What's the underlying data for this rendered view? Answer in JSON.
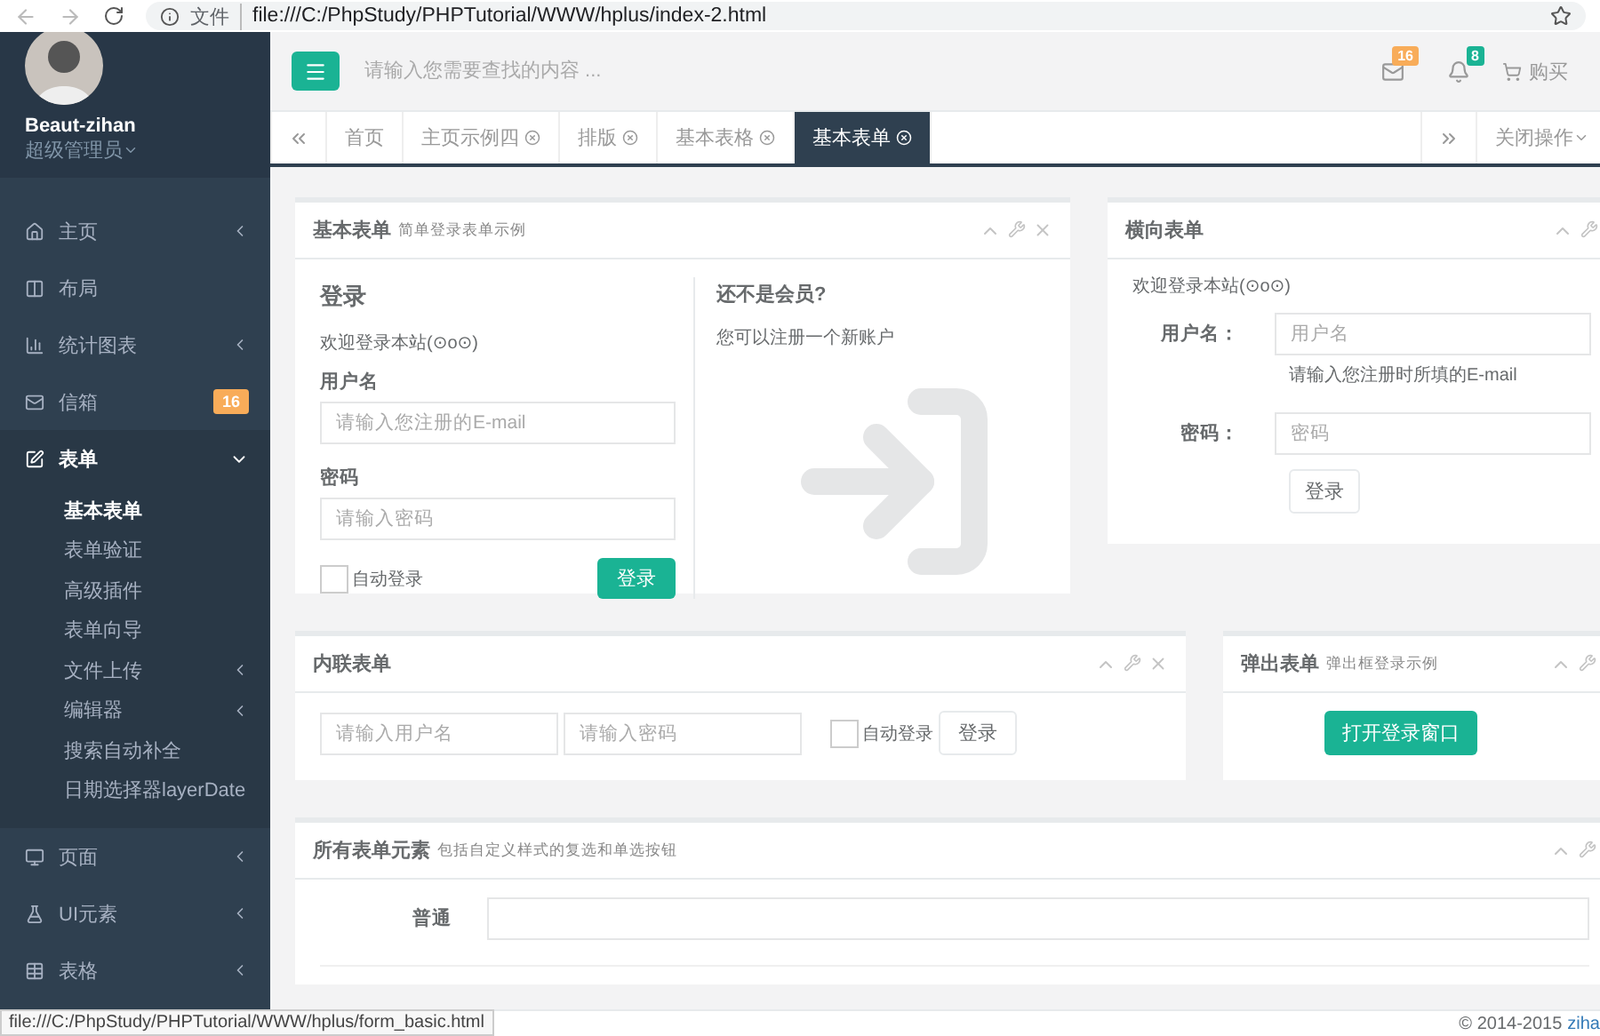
{
  "browser": {
    "scheme_label": "文件",
    "url": "file:///C:/PhpStudy/PHPTutorial/WWW/hplus/index-2.html"
  },
  "sidebar": {
    "profile": {
      "name": "Beaut-zihan",
      "role": "超级管理员"
    },
    "items": [
      {
        "label": "主页",
        "expanded": false
      },
      {
        "label": "布局"
      },
      {
        "label": "统计图表",
        "expanded": false
      },
      {
        "label": "信箱",
        "badge": "16"
      },
      {
        "label": "表单",
        "expanded": true,
        "children": [
          {
            "label": "基本表单",
            "selected": true
          },
          {
            "label": "表单验证",
            "selected": false
          },
          {
            "label": "高级插件",
            "selected": false
          },
          {
            "label": "表单向导",
            "selected": false
          },
          {
            "label": "文件上传",
            "selected": false,
            "expanded": false
          },
          {
            "label": "编辑器",
            "selected": false,
            "expanded": false
          },
          {
            "label": "搜索自动补全",
            "selected": false
          },
          {
            "label": "日期选择器layerDate",
            "selected": false
          }
        ]
      },
      {
        "label": "页面",
        "expanded": false
      },
      {
        "label": "UI元素",
        "expanded": false
      },
      {
        "label": "表格",
        "expanded": false
      }
    ]
  },
  "header": {
    "search": {
      "placeholder": "请输入您需要查找的内容 ..."
    },
    "mail_count": "16",
    "alert_count": "8",
    "buy": "购买"
  },
  "tabs": {
    "items": [
      {
        "label": "首页",
        "selected": false,
        "closable": false
      },
      {
        "label": "主页示例四",
        "selected": false,
        "closable": true
      },
      {
        "label": "排版",
        "selected": false,
        "closable": true
      },
      {
        "label": "基本表格",
        "selected": false,
        "closable": true
      },
      {
        "label": "基本表单",
        "selected": true,
        "closable": true
      }
    ],
    "close_menu": "关闭操作"
  },
  "basic_form": {
    "title": "基本表单",
    "subtitle": "简单登录表单示例",
    "heading": "登录",
    "welcome": "欢迎登录本站(⊙o⊙)",
    "username_label": "用户名",
    "username_placeholder": "请输入您注册的E-mail",
    "password_label": "密码",
    "password_placeholder": "请输入密码",
    "remember": {
      "label": "自动登录",
      "checked": false
    },
    "submit": "登录",
    "side_heading": "还不是会员?",
    "side_text": "您可以注册一个新账户"
  },
  "horizontal_form": {
    "title": "横向表单",
    "welcome": "欢迎登录本站(⊙o⊙)",
    "username_label": "用户名：",
    "username_placeholder": "用户名",
    "help": "请输入您注册时所填的E-mail",
    "password_label": "密码：",
    "password_placeholder": "密码",
    "submit": "登录"
  },
  "inline_form": {
    "title": "内联表单",
    "username_placeholder": "请输入用户名",
    "password_placeholder": "请输入密码",
    "remember": {
      "label": "自动登录",
      "checked": false
    },
    "submit": "登录"
  },
  "popup_form": {
    "title": "弹出表单",
    "subtitle": "弹出框登录示例",
    "open_button": "打开登录窗口"
  },
  "all_elements": {
    "title": "所有表单元素",
    "subtitle": "包括自定义样式的复选和单选按钮",
    "rows": [
      {
        "label": "普通"
      }
    ]
  },
  "footer": {
    "copyright": "© 2014-2015",
    "link": "ziha"
  },
  "status_url": "file:///C:/PhpStudy/PHPTutorial/WWW/hplus/form_basic.html"
}
